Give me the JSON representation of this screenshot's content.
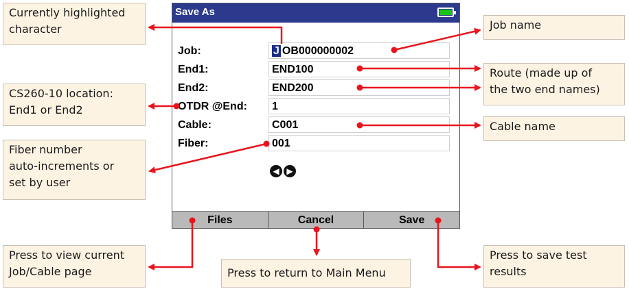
{
  "screen": {
    "title": "Save As",
    "battery_color": "#19c419",
    "fields": [
      {
        "label": "Job:",
        "value_highlighted": "J",
        "value_rest": "OB000000002"
      },
      {
        "label": "End1:",
        "value": "END100"
      },
      {
        "label": "End2:",
        "value": "END200"
      },
      {
        "label": "OTDR @End:",
        "value": "1"
      },
      {
        "label": "Cable:",
        "value": "C001"
      },
      {
        "label": "Fiber:",
        "value": "001"
      }
    ],
    "nav_arrows": {
      "left": "◀",
      "right": "▶"
    },
    "softkeys": {
      "files": "Files",
      "cancel": "Cancel",
      "save": "Save"
    }
  },
  "callouts": {
    "highlighted_char": "Currently highlighted\ncharacter",
    "location": "CS260-10 location:\nEnd1 or End2",
    "fiber": "Fiber number\nauto-increments or\nset by user",
    "files": "Press to view current\nJob/Cable page",
    "job_name": "Job name",
    "route": "Route (made up of\nthe two end names)",
    "cable_name": "Cable name",
    "cancel": "Press to return to Main Menu",
    "save": "Press to save test\nresults"
  },
  "colors": {
    "title_bar": "#2b3a8c",
    "highlight": "#1c2c8c",
    "softkey_bar": "#b9b9b9",
    "callout_fill": "#fdf3e3",
    "connector": "#e8141e"
  }
}
